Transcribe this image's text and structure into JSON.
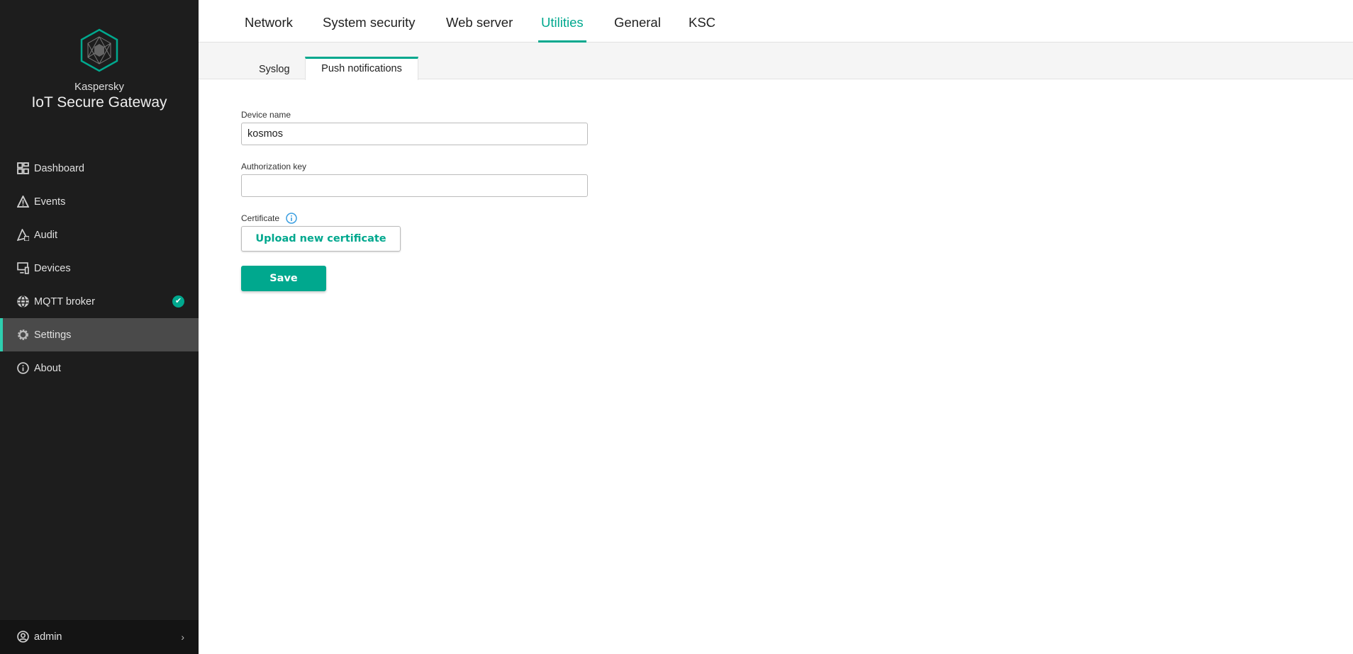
{
  "app": {
    "vendor": "Kaspersky",
    "product": "IoT Secure Gateway"
  },
  "sidebar": {
    "items": [
      {
        "label": "Dashboard",
        "icon": "dashboard-icon"
      },
      {
        "label": "Events",
        "icon": "warning-icon"
      },
      {
        "label": "Audit",
        "icon": "audit-icon"
      },
      {
        "label": "Devices",
        "icon": "devices-icon"
      },
      {
        "label": "MQTT broker",
        "icon": "globe-icon",
        "status": "ok"
      },
      {
        "label": "Settings",
        "icon": "gear-icon",
        "active": true
      },
      {
        "label": "About",
        "icon": "info-icon"
      }
    ],
    "user": "admin"
  },
  "tabs": [
    "Network",
    "System security",
    "Web server",
    "Utilities",
    "General",
    "KSC"
  ],
  "active_tab": "Utilities",
  "subtabs": [
    "Syslog",
    "Push notifications"
  ],
  "active_subtab": "Push notifications",
  "form": {
    "device_name_label": "Device name",
    "device_name_value": "kosmos",
    "auth_key_label": "Authorization key",
    "auth_key_value": "",
    "certificate_label": "Certificate",
    "upload_label": "Upload new certificate",
    "save_label": "Save"
  },
  "colors": {
    "accent": "#00a88e",
    "sidebar": "#1d1d1d",
    "info": "#3a9ee0"
  }
}
